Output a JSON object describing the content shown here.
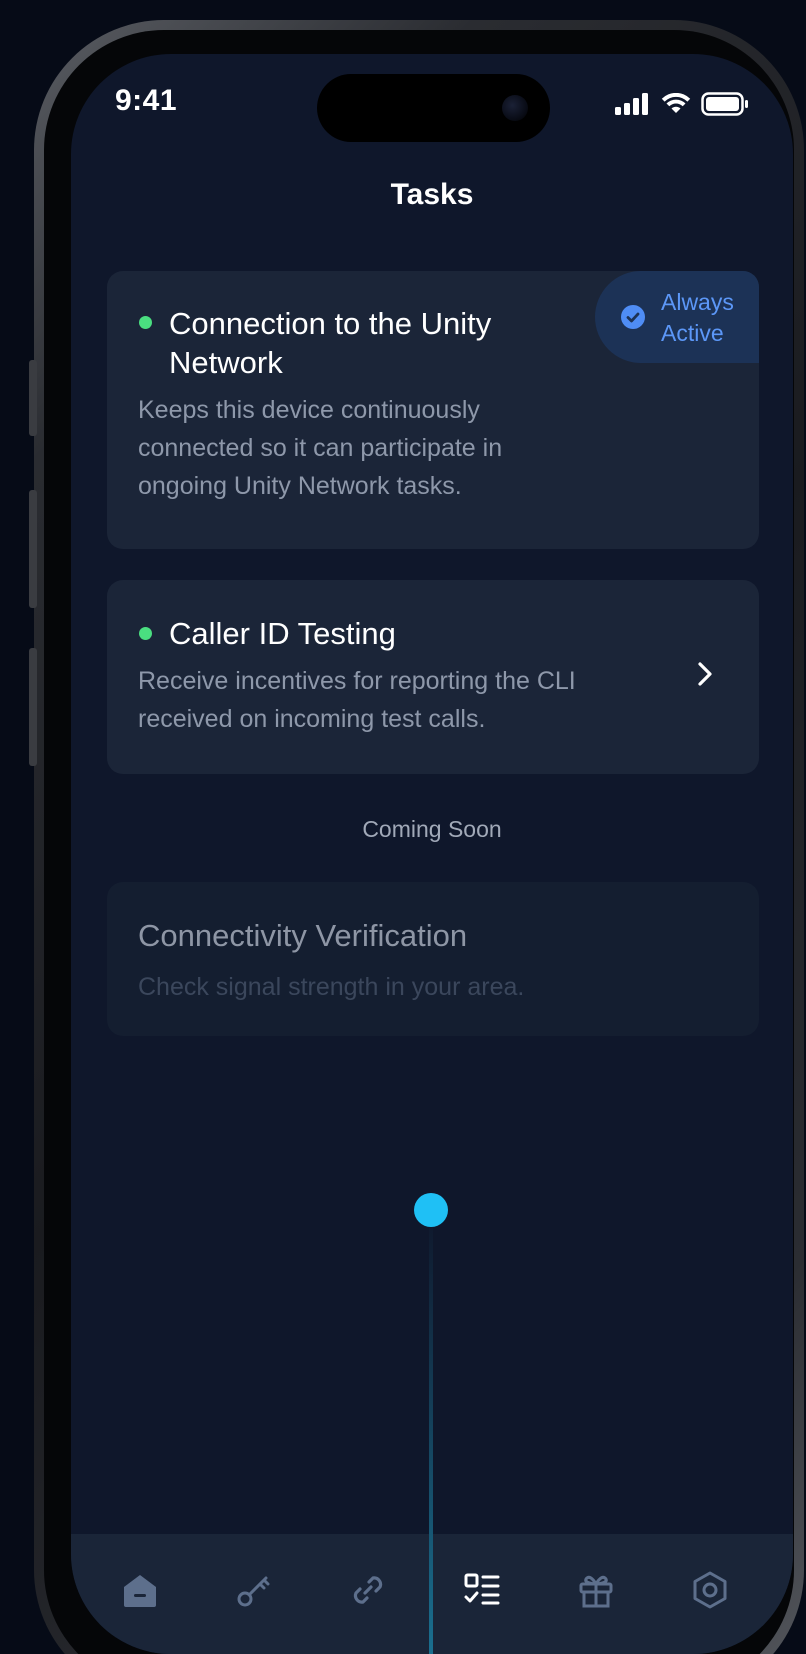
{
  "status_bar": {
    "time": "9:41"
  },
  "header": {
    "title": "Tasks"
  },
  "tasks": [
    {
      "title": "Connection to the Unity Network",
      "description": "Keeps this device continuously connected so it can participate in ongoing Unity Network tasks.",
      "status_color": "#4ade80",
      "badge": {
        "label": "Always Active",
        "icon": "check-circle-icon"
      }
    },
    {
      "title": "Caller ID Testing",
      "description": "Receive incentives for reporting the CLI received on incoming test calls.",
      "status_color": "#4ade80",
      "action_icon": "chevron-right-icon"
    }
  ],
  "coming_soon": {
    "label": "Coming Soon",
    "items": [
      {
        "title": "Connectivity Verification",
        "description": "Check signal strength in your area."
      }
    ]
  },
  "tab_bar": {
    "items": [
      {
        "icon": "home-icon",
        "active": false
      },
      {
        "icon": "key-icon",
        "active": false
      },
      {
        "icon": "link-icon",
        "active": false
      },
      {
        "icon": "tasks-icon",
        "active": true
      },
      {
        "icon": "gift-icon",
        "active": false
      },
      {
        "icon": "settings-icon",
        "active": false
      }
    ]
  },
  "colors": {
    "background": "#0f172b",
    "card": "#1b2538",
    "accent_blue": "#5c97f7",
    "status_green": "#4ade80",
    "indicator": "#1fc0f5"
  }
}
